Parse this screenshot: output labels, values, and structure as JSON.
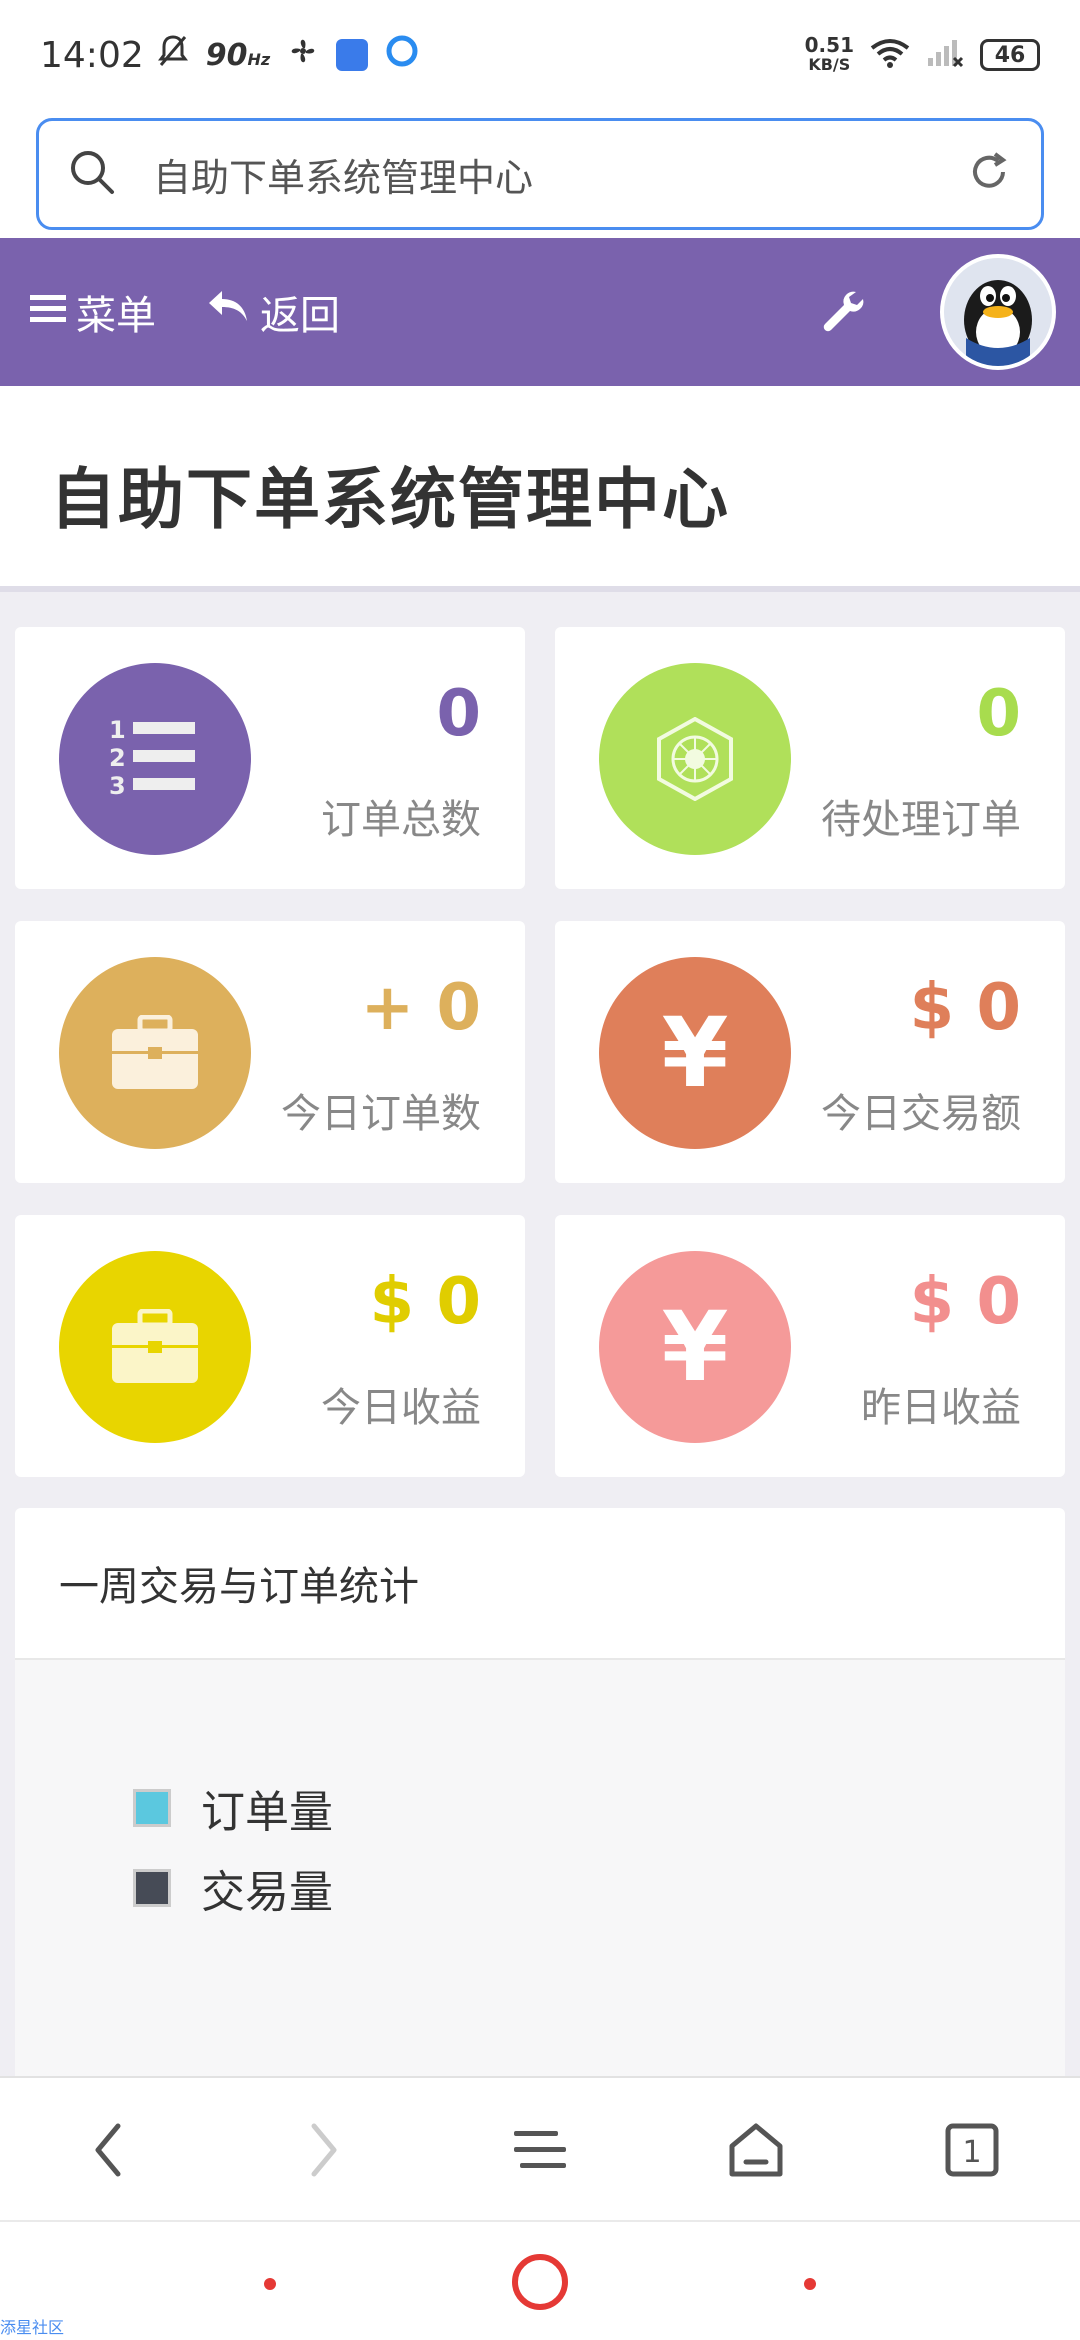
{
  "status_bar": {
    "time": "14:02",
    "refresh_rate": "90",
    "refresh_unit": "Hz",
    "net_speed_value": "0.51",
    "net_speed_unit": "KB/S",
    "battery": "46"
  },
  "search": {
    "placeholder": "自助下单系统管理中心"
  },
  "top_nav": {
    "menu_label": "菜单",
    "back_label": "返回"
  },
  "page": {
    "title": "自助下单系统管理中心"
  },
  "stats": [
    {
      "value": "0",
      "label": "订单总数",
      "color": "#7a62ad",
      "value_color": "#7a62ad",
      "icon": "ordered-list-icon"
    },
    {
      "value": "0",
      "label": "待处理订单",
      "color": "#b0e05a",
      "value_color": "#a8dc4e",
      "icon": "hexagon-icon"
    },
    {
      "value": "+ 0",
      "label": "今日订单数",
      "color": "#ddb05c",
      "value_color": "#ddb05c",
      "icon": "briefcase-icon"
    },
    {
      "value": "$ 0",
      "label": "今日交易额",
      "color": "#df7f5a",
      "value_color": "#df7f5a",
      "icon": "yen-icon"
    },
    {
      "value": "$ 0",
      "label": "今日收益",
      "color": "#e8d500",
      "value_color": "#e0cd00",
      "icon": "briefcase-icon"
    },
    {
      "value": "$ 0",
      "label": "昨日收益",
      "color": "#f59a99",
      "value_color": "#f28f8e",
      "icon": "yen-icon"
    }
  ],
  "weekly_chart": {
    "title": "一周交易与订单统计",
    "legend": [
      {
        "label": "订单量",
        "color": "#5bc8df"
      },
      {
        "label": "交易量",
        "color": "#464b56"
      }
    ]
  },
  "watermark": "添星社区"
}
